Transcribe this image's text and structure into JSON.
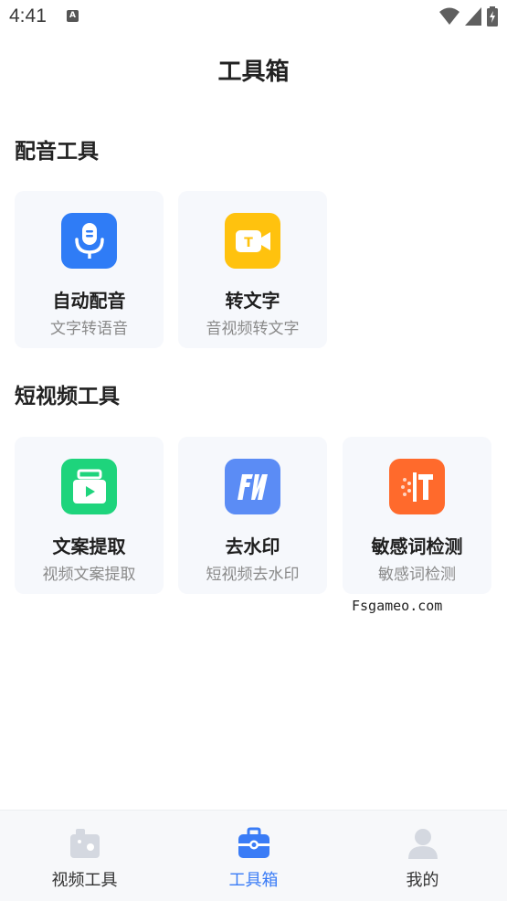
{
  "status_bar": {
    "time": "4:41",
    "notification_icon": "A"
  },
  "header": {
    "title": "工具箱"
  },
  "sections": [
    {
      "title": "配音工具",
      "cards": [
        {
          "title": "自动配音",
          "subtitle": "文字转语音",
          "icon": "microphone-icon",
          "color": "#2f7cf6"
        },
        {
          "title": "转文字",
          "subtitle": "音视频转文字",
          "icon": "video-to-text-icon",
          "color": "#ffc20e"
        }
      ]
    },
    {
      "title": "短视频工具",
      "cards": [
        {
          "title": "文案提取",
          "subtitle": "视频文案提取",
          "icon": "play-document-icon",
          "color": "#1ed47c"
        },
        {
          "title": "去水印",
          "subtitle": "短视频去水印",
          "icon": "watermark-remove-icon",
          "color": "#5b8cf5"
        },
        {
          "title": "敏感词检测",
          "subtitle": "敏感词检测",
          "icon": "sensitive-word-icon",
          "color": "#ff6a2c"
        }
      ]
    }
  ],
  "watermark": "Fsgameo.com",
  "bottom_nav": {
    "items": [
      {
        "label": "视频工具",
        "icon": "video-tools-icon",
        "active": false
      },
      {
        "label": "工具箱",
        "icon": "toolbox-icon",
        "active": true
      },
      {
        "label": "我的",
        "icon": "profile-icon",
        "active": false
      }
    ],
    "active_color": "#3a7cf6"
  }
}
